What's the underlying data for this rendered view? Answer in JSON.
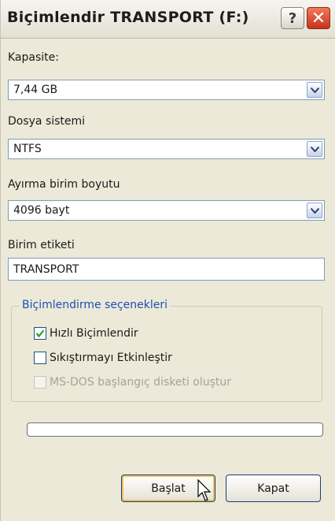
{
  "window": {
    "title": "Biçimlendir TRANSPORT (F:)",
    "help_icon": "question-mark",
    "close_icon": "x"
  },
  "capacity": {
    "label": "Kapasite:",
    "value": "7,44 GB"
  },
  "file_system": {
    "label": "Dosya sistemi",
    "value": "NTFS"
  },
  "allocation_unit": {
    "label": "Ayırma birim boyutu",
    "value": "4096 bayt"
  },
  "volume_label": {
    "label": "Birim etiketi",
    "value": "TRANSPORT"
  },
  "format_options": {
    "title": "Biçimlendirme seçenekleri",
    "items": [
      {
        "label": "Hızlı Biçimlendir",
        "checked": true,
        "enabled": true
      },
      {
        "label": "Sıkıştırmayı Etkinleştir",
        "checked": false,
        "enabled": true
      },
      {
        "label": "MS-DOS başlangıç disketi oluştur",
        "checked": false,
        "enabled": false
      }
    ]
  },
  "progress": {
    "value": 0
  },
  "buttons": {
    "start": "Başlat",
    "close": "Kapat"
  },
  "colors": {
    "group_title": "#1e50b4",
    "close_button": "#c7321a",
    "progress_fill": "#2fbf1f"
  }
}
